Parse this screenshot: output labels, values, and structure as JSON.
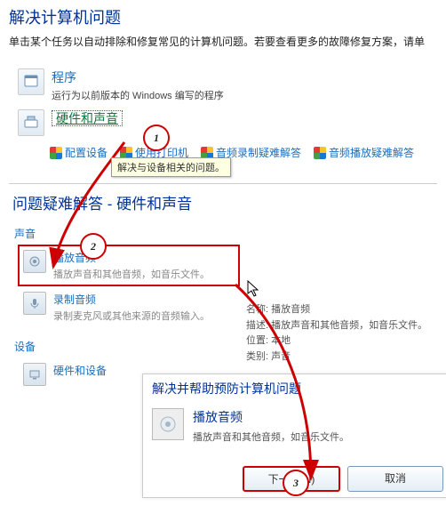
{
  "header": {
    "title": "解决计算机问题",
    "subtitle": "单击某个任务以自动排除和修复常见的计算机问题。若要查看更多的故障修复方案，请单"
  },
  "sections": {
    "programs": {
      "title": "程序",
      "desc": "运行为以前版本的 Windows 编写的程序"
    },
    "hardware": {
      "title": "硬件和声音",
      "links": {
        "configDevice": "配置设备",
        "usePrinter": "使用打印机",
        "recordTrouble": "音频录制疑难解答",
        "playTrouble": "音频播放疑难解答"
      },
      "tooltip": "解决与设备相关的问题。"
    }
  },
  "troubleshoot": {
    "title": "问题疑难解答 - 硬件和声音",
    "groups": {
      "sound": "声音",
      "device": "设备"
    },
    "items": {
      "playAudio": {
        "title": "播放音频",
        "desc": "播放声音和其他音频，如音乐文件。"
      },
      "recordAudio": {
        "title": "录制音频",
        "desc": "录制麦克风或其他来源的音频输入。"
      },
      "hwDevice": {
        "title": "硬件和设备"
      }
    },
    "info": {
      "nameLabel": "名称:",
      "nameVal": "播放音频",
      "descLabel": "描述:",
      "descVal": "播放声音和其他音频，如音乐文件。",
      "locLabel": "位置:",
      "locVal": "本地",
      "catLabel": "类别:",
      "catVal": "声音"
    }
  },
  "wizard": {
    "heading": "解决并帮助预防计算机问题",
    "title": "播放音频",
    "desc": "播放声音和其他音频，如音乐文件。",
    "next": "下一步(N)",
    "cancel": "取消"
  },
  "markers": {
    "m1": "1",
    "m2": "2",
    "m3": "3"
  }
}
